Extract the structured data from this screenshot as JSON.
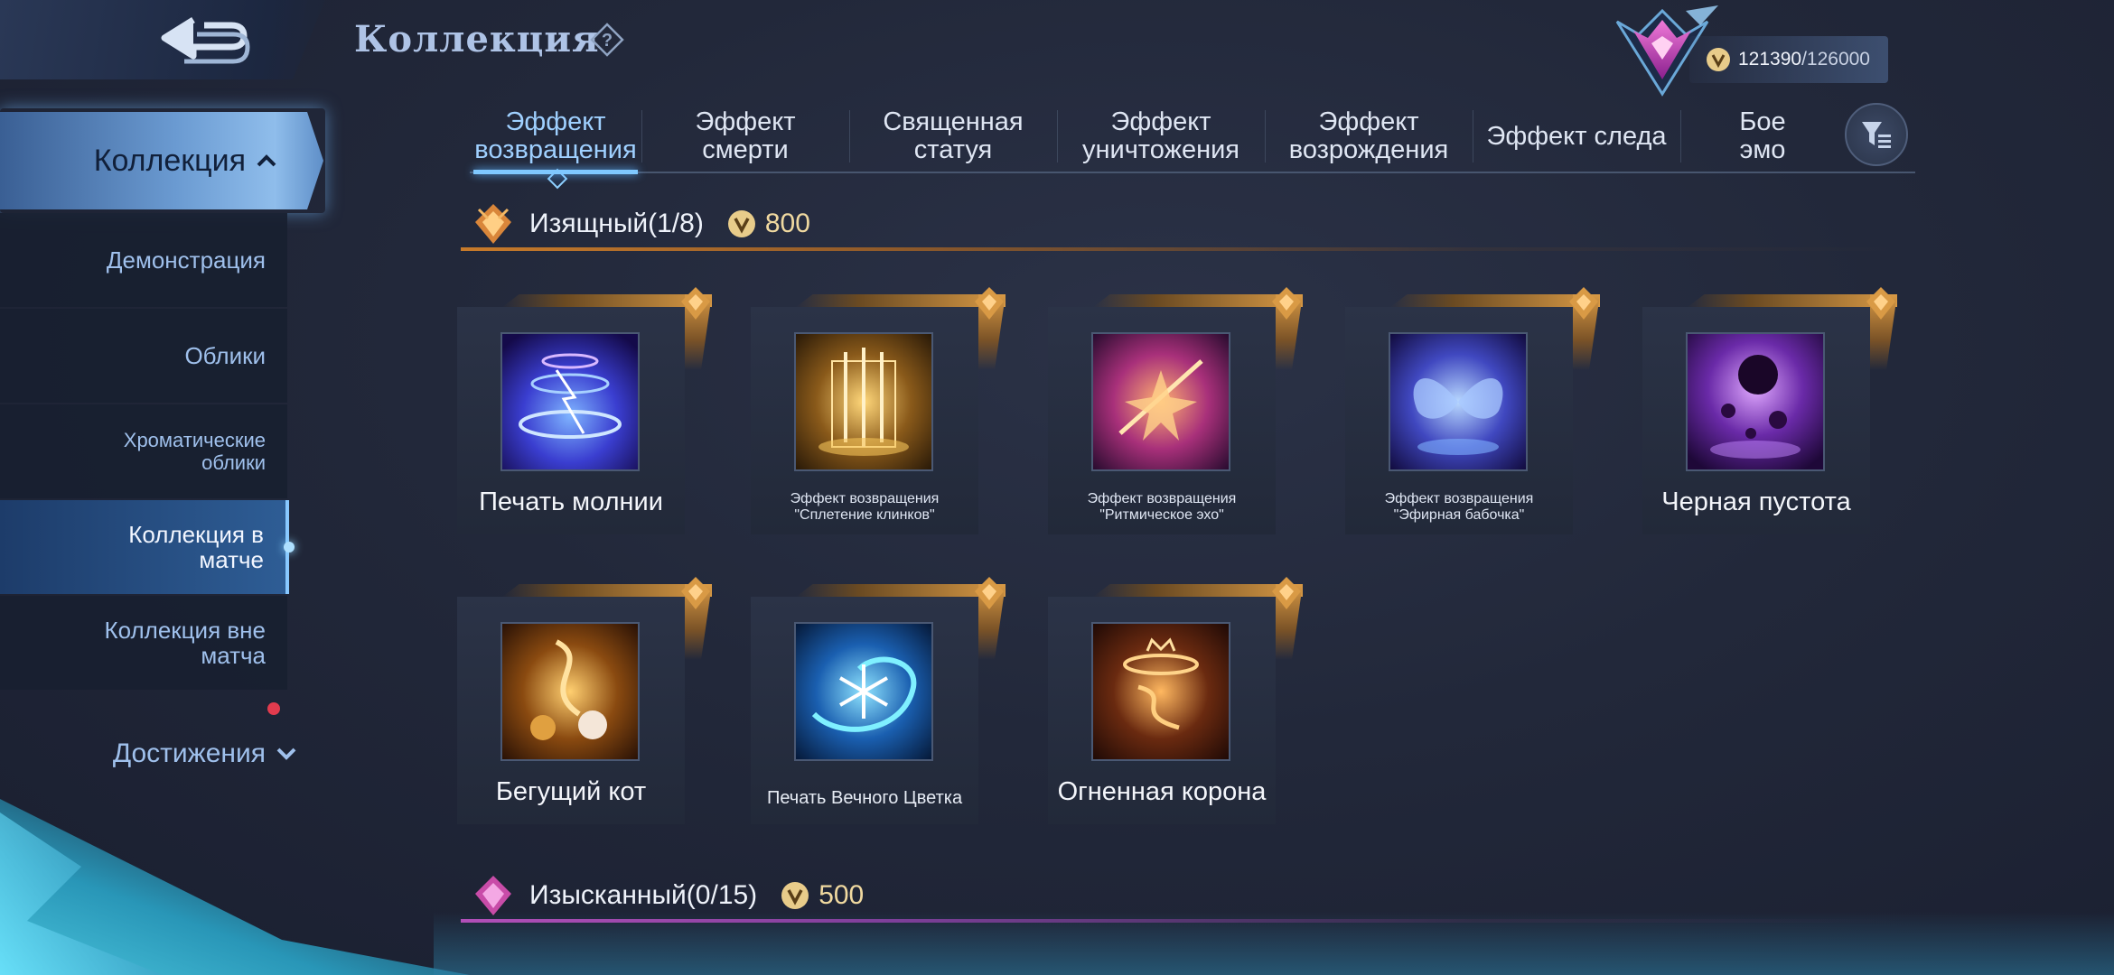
{
  "header": {
    "title": "Коллекция",
    "points_current": "121390",
    "points_max": "/126000"
  },
  "sidebar": {
    "head": "Коллекция",
    "items": [
      {
        "label": "Демонстрация"
      },
      {
        "label": "Облики"
      },
      {
        "label": "Хроматические облики"
      },
      {
        "label": "Коллекция в матче"
      },
      {
        "label": "Коллекция вне матча"
      }
    ],
    "achievements": "Достижения"
  },
  "tabs": [
    {
      "label": "Эффект возвращения"
    },
    {
      "label": "Эффект смерти"
    },
    {
      "label": "Священная статуя"
    },
    {
      "label": "Эффект уничтожения"
    },
    {
      "label": "Эффект возрождения"
    },
    {
      "label": "Эффект следа"
    },
    {
      "label": "Бое эмо"
    }
  ],
  "sections": [
    {
      "title": "Изящный(1/8)",
      "price": "800"
    },
    {
      "title": "Изысканный(0/15)",
      "price": "500"
    }
  ],
  "cards": [
    {
      "name": "Печать молнии"
    },
    {
      "name": "Эффект возвращения \"Сплетение клинков\""
    },
    {
      "name": "Эффект возвращения \"Ритмическое эхо\""
    },
    {
      "name": "Эффект возвращения \"Эфирная бабочка\""
    },
    {
      "name": "Черная пустота"
    },
    {
      "name": "Бегущий кот"
    },
    {
      "name": "Печать Вечного Цветка"
    },
    {
      "name": "Огненная корона"
    }
  ],
  "colors": {
    "accent_blue": "#7fc8ff",
    "gold_frame": "#d99a45",
    "rank_purple": "#c23bb0"
  }
}
